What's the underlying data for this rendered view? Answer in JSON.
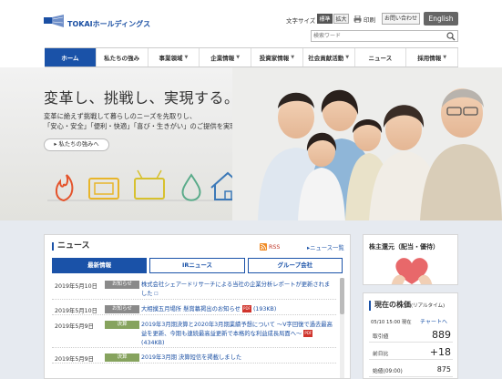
{
  "header": {
    "logo_text": "TOKAIホールディングス",
    "fontsize_label": "文字サイズ",
    "fontsize_standard": "標準",
    "fontsize_large": "拡大",
    "print_label": "印刷",
    "contact_label": "お問い合わせ",
    "english_label": "English",
    "search_placeholder": "検索ワード"
  },
  "nav": {
    "items": [
      {
        "label": "ホーム",
        "active": true,
        "caret": false
      },
      {
        "label": "私たちの強み",
        "active": false,
        "caret": false
      },
      {
        "label": "事業領域",
        "active": false,
        "caret": true
      },
      {
        "label": "企業情報",
        "active": false,
        "caret": true
      },
      {
        "label": "投資家情報",
        "active": false,
        "caret": true
      },
      {
        "label": "社会貢献活動",
        "active": false,
        "caret": true
      },
      {
        "label": "ニュース",
        "active": false,
        "caret": false
      },
      {
        "label": "採用情報",
        "active": false,
        "caret": true
      }
    ]
  },
  "hero": {
    "title": "変革し、挑戦し、実現する。",
    "line1": "変革に絶えず挑戦して暮らしのニーズを先取りし、",
    "line2": "「安心・安全」「便利・快適」「喜び・生きがい」のご提供を実現します。",
    "button": "私たちの強みへ"
  },
  "news": {
    "title": "ニュース",
    "rss": "RSS",
    "all_link": "ニュース一覧",
    "tabs": [
      "最新情報",
      "IRニュース",
      "グループ会社"
    ],
    "active_tab": 0,
    "items": [
      {
        "date": "2019年5月10日",
        "category": "お知らせ",
        "type": "info",
        "text": "株式会社シェアードリサーチによる当社の企業分析レポートが更新されました",
        "pdf": ""
      },
      {
        "date": "2019年5月10日",
        "category": "お知らせ",
        "type": "info",
        "text": "大相撲五月場所 懸賞幕掲出のお知らせ",
        "pdf": "193KB"
      },
      {
        "date": "2019年5月9日",
        "category": "決算",
        "type": "kessan",
        "text": "2019年3月期決算と2020年3月期業績予想について ～V字回復で過去最高益を更新、今期も連続最高益更新で本格的な利益成長局面へ～",
        "pdf": "434KB"
      },
      {
        "date": "2019年5月9日",
        "category": "決算",
        "type": "kessan",
        "text": "2019年3月期 決算短信を掲載しました",
        "pdf": ""
      }
    ]
  },
  "shareholder": {
    "title": "株主還元（配当・優待）"
  },
  "stock": {
    "title": "現在の株価",
    "subtitle": "(リアルタイム)",
    "time": "05/10 15:00 現在",
    "chart_link": "チャートへ",
    "rows": [
      {
        "label": "取引値",
        "value": "889"
      },
      {
        "label": "前日比",
        "value": "+18"
      },
      {
        "label": "始値(09:00)",
        "value": "875"
      }
    ]
  },
  "colors": {
    "brand_blue": "#1a52a8",
    "kessan_green": "#86a35e",
    "pdf_red": "#d0342c"
  }
}
